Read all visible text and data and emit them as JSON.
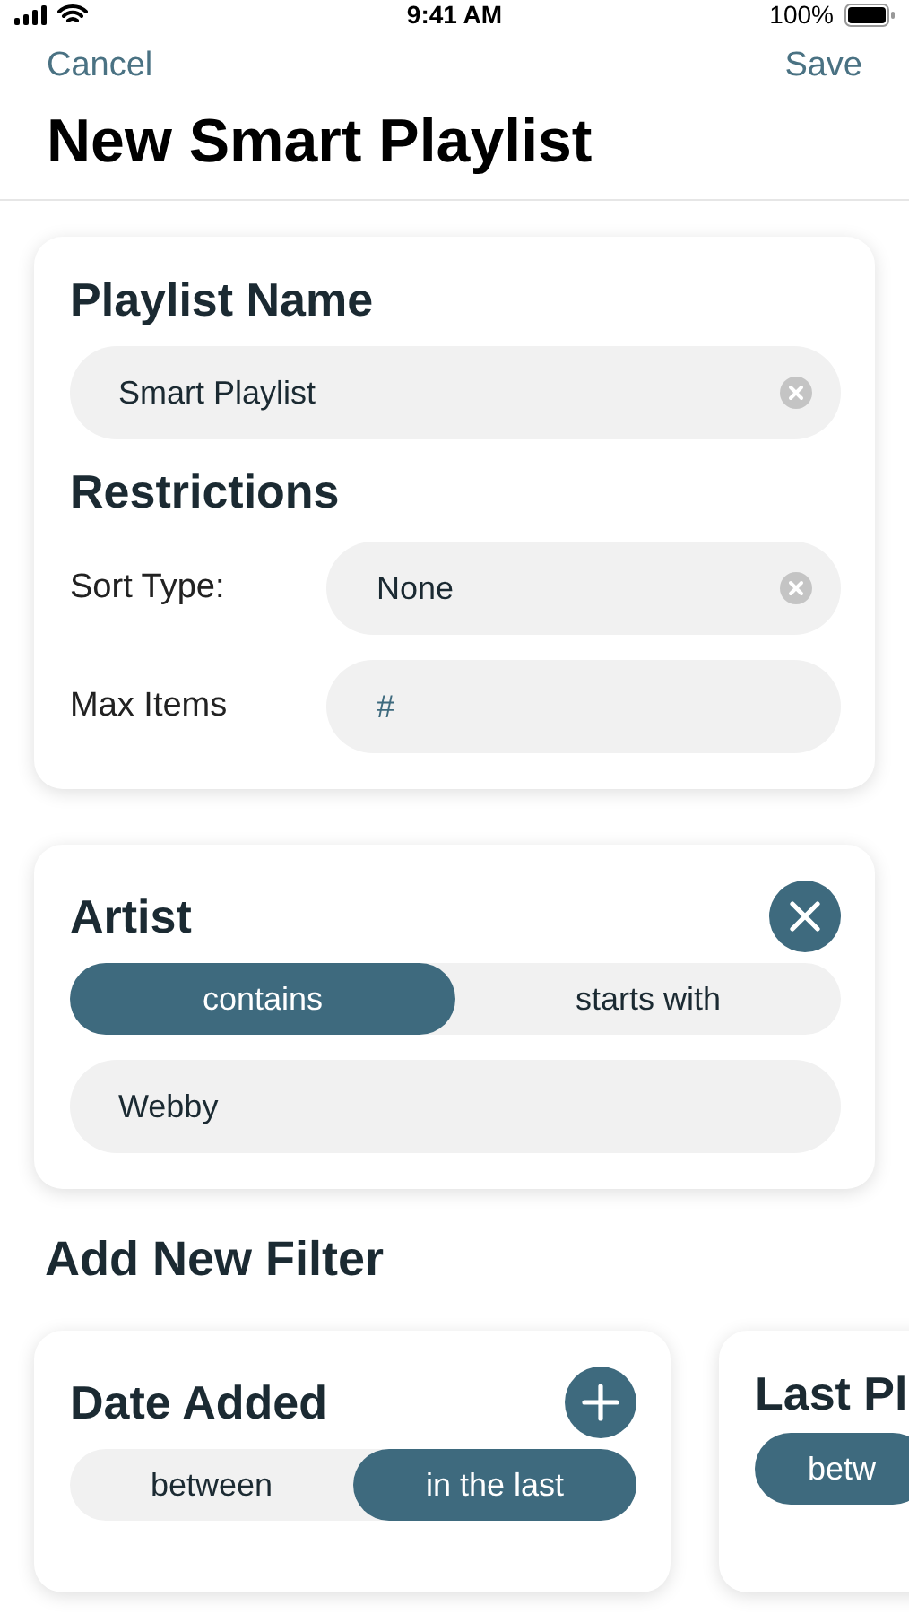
{
  "status_bar": {
    "time": "9:41 AM",
    "battery": "100%"
  },
  "nav": {
    "cancel": "Cancel",
    "save": "Save"
  },
  "title": "New Smart Playlist",
  "playlist_card": {
    "name_heading": "Playlist Name",
    "name_value": "Smart Playlist",
    "restrictions_heading": "Restrictions",
    "rows": [
      {
        "label": "Sort Type:",
        "value": "None",
        "clearable": true
      },
      {
        "label": "Max Items",
        "placeholder": "#",
        "clearable": false
      }
    ]
  },
  "active_filters": [
    {
      "title": "Artist",
      "options": [
        {
          "label": "contains",
          "selected": true
        },
        {
          "label": "starts with",
          "selected": false
        }
      ],
      "value": "Webby"
    }
  ],
  "add_filter_heading": "Add New Filter",
  "available_filters": [
    {
      "title": "Date Added",
      "addable": true,
      "options": [
        {
          "label": "between",
          "selected": false
        },
        {
          "label": "in the last",
          "selected": true
        }
      ]
    },
    {
      "title": "Last Pl",
      "addable": false,
      "options": [
        {
          "label": "betw",
          "selected": true
        }
      ]
    }
  ]
}
